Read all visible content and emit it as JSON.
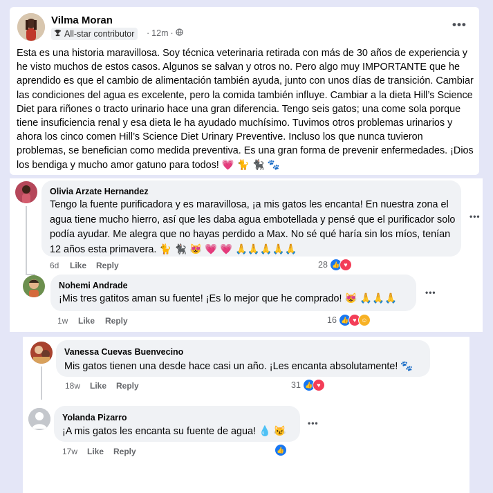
{
  "post": {
    "author": "Vilma Moran",
    "badge": "All-star contributor",
    "time": "12m",
    "more": "•••",
    "text": "Esta es una historia maravillosa. Soy técnica veterinaria retirada con más de 30 años de experiencia y he visto muchos de estos casos. Algunos se salvan y otros no. Pero algo muy IMPORTANTE que he aprendido es que el cambio de alimentación también ayuda, junto con unos días de transición. Cambiar las condiciones del agua es excelente, pero la comida también influye. Cambiar a la dieta Hill’s Science Diet para riñones o tracto urinario hace una gran diferencia. Tengo seis gatos; una come sola porque tiene insuficiencia renal y esa dieta le ha ayudado muchísimo. Tuvimos otros problemas urinarios y ahora los cinco comen Hill’s Science Diet Urinary Preventive. Incluso los que nunca tuvieron problemas, se benefician como medida preventiva. Es una gran forma de prevenir enfermedades. ¡Dios los bendiga y mucho amor gatuno para todos! 💗 🐈 🐈‍⬛ 🐾"
  },
  "comments": [
    {
      "author": "Olivia Arzate Hernandez",
      "text": "Tengo la fuente purificadora y es maravillosa, ¡a mis gatos les encanta! En nuestra zona el agua tiene mucho hierro, así que les daba agua embotellada y pensé que el purificador solo podía ayudar. Me alegra que no hayas perdido a Max. No sé qué haría sin los míos, tenían 12 años esta primavera. 🐈 🐈‍⬛ 😻 💗 💗 🙏🙏🙏🙏🙏",
      "time": "6d",
      "like": "Like",
      "reply": "Reply",
      "reactions": "28",
      "more": "•••"
    },
    {
      "author": "Nohemi Andrade",
      "text": "¡Mis tres gatitos aman su fuente! ¡Es lo mejor que he comprado! 😻 🙏🙏🙏",
      "time": "1w",
      "like": "Like",
      "reply": "Reply",
      "reactions": "16",
      "more": "•••"
    },
    {
      "author": "Vanessa Cuevas Buenvecino",
      "text": "Mis gatos tienen una desde hace casi un año. ¡Les encanta absolutamente! 🐾",
      "time": "18w",
      "like": "Like",
      "reply": "Reply",
      "reactions": "31",
      "more": "•••"
    },
    {
      "author": "Yolanda Pizarro",
      "text": "¡A mis gatos les encanta su fuente de agua! 💧 😼",
      "time": "17w",
      "like": "Like",
      "reply": "Reply",
      "reactions": "",
      "more": "•••"
    }
  ],
  "icons": {
    "badge": "trophy-icon",
    "privacy": "globe-icon",
    "like_reaction": "thumbs-up-icon",
    "love_reaction": "heart-icon",
    "care_reaction": "care-face-icon"
  },
  "colors": {
    "like_blue": "#1877f2",
    "love_red": "#f33e58",
    "care_yellow": "#f7b125",
    "bubble_gray": "#f0f2f5",
    "meta_gray": "#65676b",
    "backdrop": "#e4e6f7"
  }
}
